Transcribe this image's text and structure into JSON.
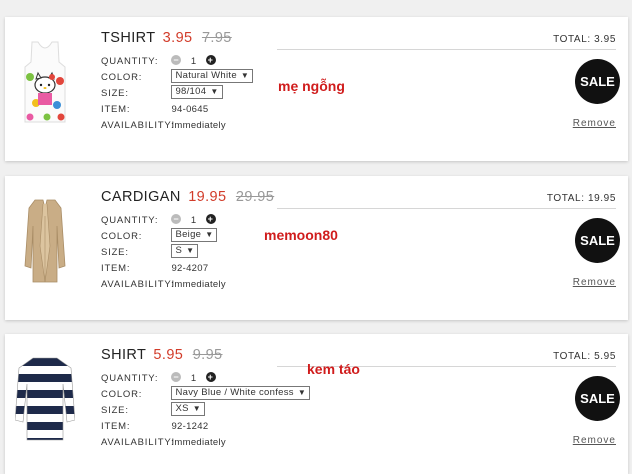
{
  "items": [
    {
      "name": "TSHIRT",
      "price": "3.95",
      "old_price": "7.95",
      "total": "TOTAL: 3.95",
      "quantity_label": "QUANTITY:",
      "quantity": "1",
      "color_label": "COLOR:",
      "color_value": "Natural White",
      "size_label": "SIZE:",
      "size_value": "98/104",
      "item_label": "ITEM:",
      "item_value": "94-0645",
      "availability_label": "AVAILABILITY:",
      "availability_value": "Immediately",
      "sale_label": "SALE",
      "remove_label": "Remove",
      "overlay_text": "mẹ ngỗng",
      "image_icon": "hello-kitty-tank-top"
    },
    {
      "name": "CARDIGAN",
      "price": "19.95",
      "old_price": "29.95",
      "total": "TOTAL: 19.95",
      "quantity_label": "QUANTITY:",
      "quantity": "1",
      "color_label": "COLOR:",
      "color_value": "Beige",
      "size_label": "SIZE:",
      "size_value": "S",
      "item_label": "ITEM:",
      "item_value": "92-4207",
      "availability_label": "AVAILABILITY:",
      "availability_value": "Immediately",
      "sale_label": "SALE",
      "remove_label": "Remove",
      "overlay_text": "memoon80",
      "image_icon": "beige-cardigan"
    },
    {
      "name": "SHIRT",
      "price": "5.95",
      "old_price": "9.95",
      "total": "TOTAL: 5.95",
      "quantity_label": "QUANTITY:",
      "quantity": "1",
      "color_label": "COLOR:",
      "color_value": "Navy Blue / White confess",
      "size_label": "SIZE:",
      "size_value": "XS",
      "item_label": "ITEM:",
      "item_value": "92-1242",
      "availability_label": "AVAILABILITY:",
      "availability_value": "Immediately",
      "sale_label": "SALE",
      "remove_label": "Remove",
      "overlay_text": "kem táo",
      "image_icon": "striped-shirt"
    }
  ],
  "colors": {
    "price_red": "#d23c2a",
    "overlay_red": "#d01c1c",
    "sale_badge": "#111111"
  }
}
